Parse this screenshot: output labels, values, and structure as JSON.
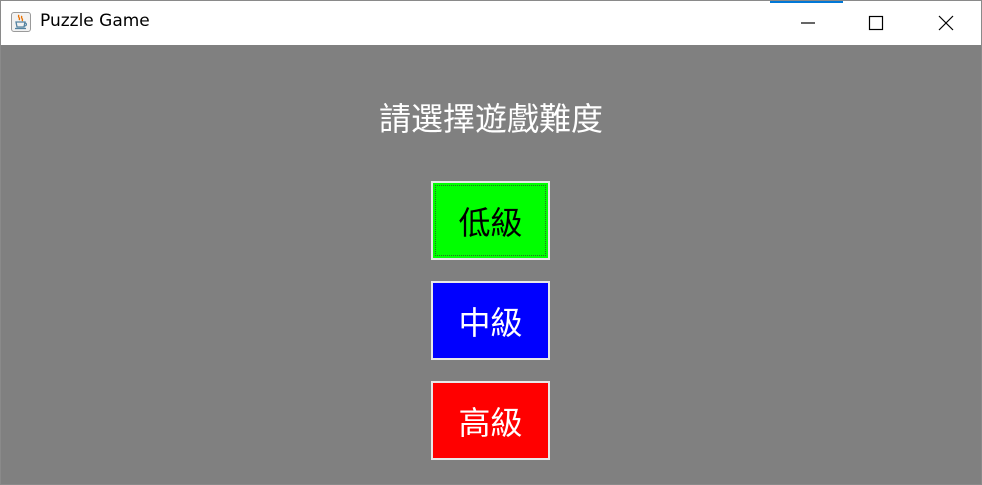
{
  "window": {
    "title": "Puzzle Game",
    "icon": "java-coffee-cup-icon",
    "controls": [
      "minimize-icon",
      "maximize-icon",
      "close-icon"
    ],
    "accent_color": "#0078d7"
  },
  "content": {
    "background_color": "#808080",
    "prompt": "請選擇遊戲難度",
    "buttons": [
      {
        "label": "低級",
        "background": "#00ff00",
        "text_color": "#000000",
        "focused": true
      },
      {
        "label": "中級",
        "background": "#0000ff",
        "text_color": "#ffffff",
        "focused": false
      },
      {
        "label": "高級",
        "background": "#ff0000",
        "text_color": "#ffffff",
        "focused": false
      }
    ]
  }
}
